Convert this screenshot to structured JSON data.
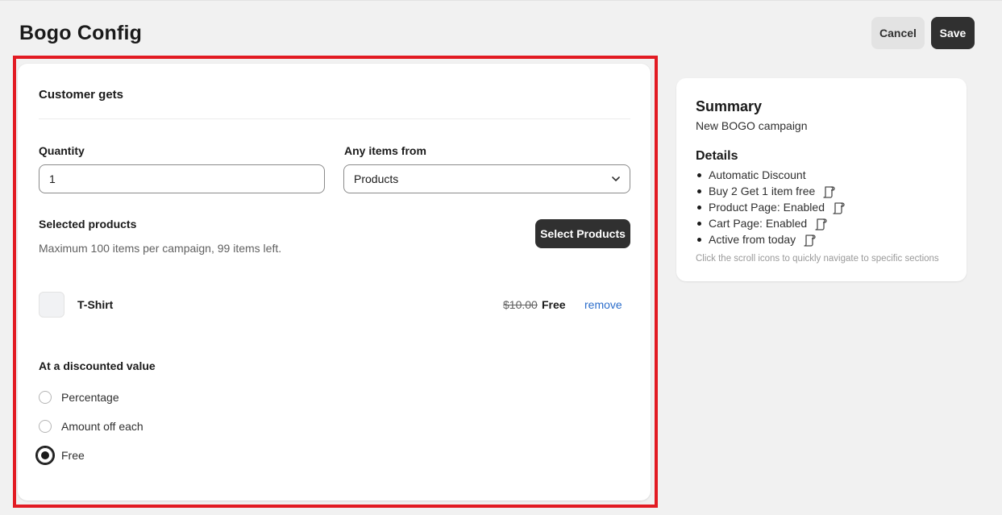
{
  "page": {
    "title": "Bogo Config"
  },
  "actions": {
    "cancel_label": "Cancel",
    "save_label": "Save"
  },
  "customer_gets": {
    "title": "Customer gets",
    "quantity": {
      "label": "Quantity",
      "value": "1"
    },
    "any_items_from": {
      "label": "Any items from",
      "selected": "Products"
    },
    "selected_products": {
      "label": "Selected products",
      "help": "Maximum 100 items per campaign, 99 items left.",
      "select_button_label": "Select Products",
      "items": [
        {
          "name": "T-Shirt",
          "original_price": "$10.00",
          "price": "Free",
          "remove_label": "remove"
        }
      ]
    },
    "discount": {
      "label": "At a discounted value",
      "options": [
        {
          "label": "Percentage",
          "checked": false
        },
        {
          "label": "Amount off each",
          "checked": false
        },
        {
          "label": "Free",
          "checked": true
        }
      ]
    }
  },
  "summary": {
    "title": "Summary",
    "subtitle": "New BOGO campaign",
    "details_title": "Details",
    "details": [
      {
        "text": "Automatic Discount",
        "icon": null
      },
      {
        "text": "Buy 2 Get 1 item free",
        "icon": "scroll-icon"
      },
      {
        "text": "Product Page: Enabled",
        "icon": "scroll-icon"
      },
      {
        "text": "Cart Page: Enabled",
        "icon": "scroll-icon"
      },
      {
        "text": "Active from today",
        "icon": "scroll-icon"
      }
    ],
    "hint": "Click the scroll icons to quickly navigate to specific sections"
  },
  "colors": {
    "highlight_border": "#e21b23",
    "primary_button": "#303030",
    "link": "#2c6ecb",
    "background": "#f1f1f1"
  }
}
